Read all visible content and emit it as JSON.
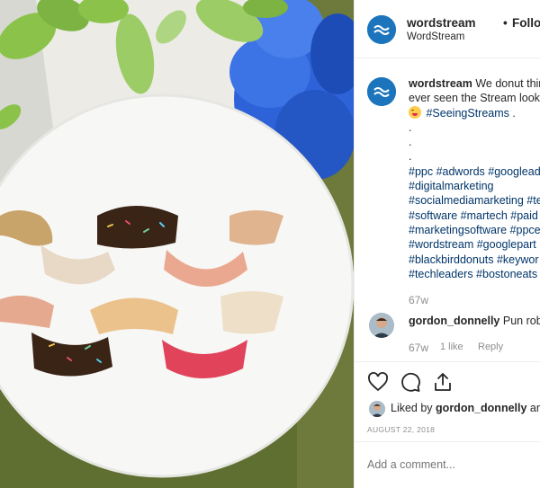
{
  "header": {
    "username": "wordstream",
    "separator": "•",
    "follow_status": "Following",
    "subtitle": "WordStream",
    "avatar_icon": "wordstream-logo-icon"
  },
  "caption": {
    "username": "wordstream",
    "line1_text": "We donut think",
    "line2_text": "ever seen the Stream look",
    "line3_hashtag": "#SeeingStreams",
    "line3_end": ".",
    "dots": [
      ".",
      ".",
      "."
    ],
    "hashtag_lines": [
      "#ppc #adwords #googlead",
      "#digitalmarketing",
      "#socialmediamarketing #te",
      "#software #martech #paid",
      "#marketingsoftware #ppce",
      "#wordstream #googlepart",
      "#blackbirddonuts #keywor",
      "#techleaders #bostoneats"
    ],
    "emoji_icon": "grinning-tongue-emoji-icon"
  },
  "caption_time": "67w",
  "comment": {
    "username": "gordon_donnelly",
    "text": "Pun robl",
    "time": "67w",
    "likes_label": "1 like",
    "reply_label": "Reply"
  },
  "actions": {
    "icons": [
      "heart-icon",
      "comment-icon",
      "share-icon"
    ]
  },
  "likes": {
    "prefix": "Liked by",
    "username": "gordon_donnelly",
    "suffix": "and"
  },
  "post_date": "AUGUST 22, 2018",
  "add_comment": {
    "placeholder": "Add a comment..."
  },
  "colors": {
    "brand_blue": "#1c75bc",
    "hashtag_blue": "#003569",
    "muted_gray": "#8e8e8e",
    "border": "#efefef"
  }
}
